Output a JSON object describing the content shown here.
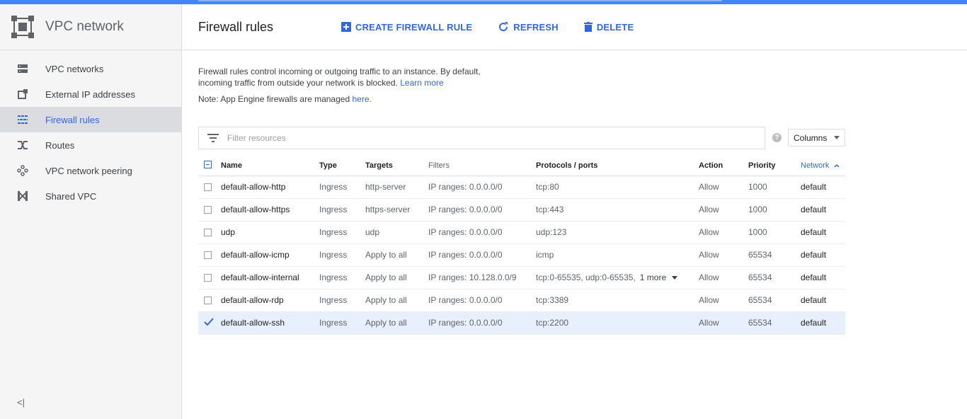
{
  "sidebar": {
    "title": "VPC network",
    "items": [
      {
        "label": "VPC networks",
        "icon": "vpc-networks-icon"
      },
      {
        "label": "External IP addresses",
        "icon": "external-ip-icon"
      },
      {
        "label": "Firewall rules",
        "icon": "firewall-icon",
        "active": true
      },
      {
        "label": "Routes",
        "icon": "routes-icon"
      },
      {
        "label": "VPC network peering",
        "icon": "peering-icon"
      },
      {
        "label": "Shared VPC",
        "icon": "shared-vpc-icon"
      }
    ],
    "collapse": "<|"
  },
  "header": {
    "title": "Firewall rules",
    "create_label": "CREATE FIREWALL RULE",
    "refresh_label": "REFRESH",
    "delete_label": "DELETE"
  },
  "description": {
    "text": "Firewall rules control incoming or outgoing traffic to an instance. By default, incoming traffic from outside your network is blocked.",
    "learn_more": "Learn more",
    "note_prefix": "Note: App Engine firewalls are managed",
    "note_link": "here."
  },
  "filter": {
    "placeholder": "Filter resources",
    "help": "?",
    "columns_label": "Columns"
  },
  "table": {
    "headers": [
      "Name",
      "Type",
      "Targets",
      "Filters",
      "Protocols / ports",
      "Action",
      "Priority",
      "Network"
    ],
    "rows": [
      {
        "name": "default-allow-http",
        "type": "Ingress",
        "targets": "http-server",
        "filters": "IP ranges: 0.0.0.0/0",
        "ports": "tcp:80",
        "action": "Allow",
        "priority": "1000",
        "network": "default",
        "checked": false
      },
      {
        "name": "default-allow-https",
        "type": "Ingress",
        "targets": "https-server",
        "filters": "IP ranges: 0.0.0.0/0",
        "ports": "tcp:443",
        "action": "Allow",
        "priority": "1000",
        "network": "default",
        "checked": false
      },
      {
        "name": "udp",
        "type": "Ingress",
        "targets": "udp",
        "filters": "IP ranges: 0.0.0.0/0",
        "ports": "udp:123",
        "action": "Allow",
        "priority": "1000",
        "network": "default",
        "checked": false
      },
      {
        "name": "default-allow-icmp",
        "type": "Ingress",
        "targets": "Apply to all",
        "filters": "IP ranges: 0.0.0.0/0",
        "ports": "icmp",
        "action": "Allow",
        "priority": "65534",
        "network": "default",
        "checked": false
      },
      {
        "name": "default-allow-internal",
        "type": "Ingress",
        "targets": "Apply to all",
        "filters": "IP ranges: 10.128.0.0/9",
        "ports": "tcp:0-65535, udp:0-65535,",
        "more": "1 more",
        "action": "Allow",
        "priority": "65534",
        "network": "default",
        "checked": false
      },
      {
        "name": "default-allow-rdp",
        "type": "Ingress",
        "targets": "Apply to all",
        "filters": "IP ranges: 0.0.0.0/0",
        "ports": "tcp:3389",
        "action": "Allow",
        "priority": "65534",
        "network": "default",
        "checked": false
      },
      {
        "name": "default-allow-ssh",
        "type": "Ingress",
        "targets": "Apply to all",
        "filters": "IP ranges: 0.0.0.0/0",
        "ports": "tcp:2200",
        "action": "Allow",
        "priority": "65534",
        "network": "default",
        "checked": true
      }
    ]
  },
  "colors": {
    "accent": "#3367d6",
    "topbar": "#4285f4",
    "selected_row": "#e8f0fe"
  }
}
